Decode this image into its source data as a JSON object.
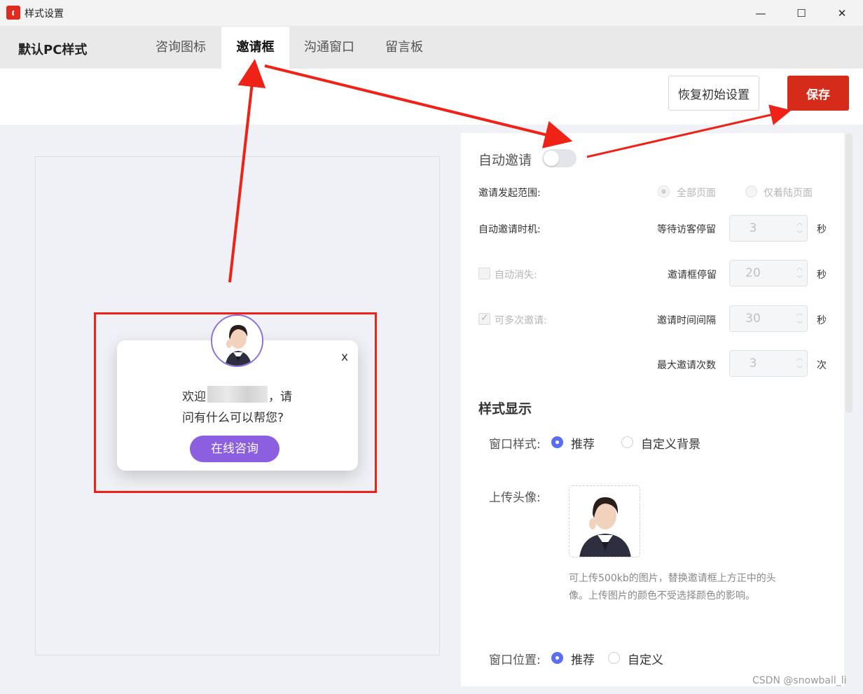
{
  "window": {
    "title": "样式设置",
    "minimize": "—",
    "maximize": "☐",
    "close": "✕"
  },
  "header": {
    "brand": "默认PC样式",
    "tabs": [
      {
        "label": "咨询图标"
      },
      {
        "label": "邀请框"
      },
      {
        "label": "沟通窗口"
      },
      {
        "label": "留言板"
      }
    ],
    "active_tab": "邀请框"
  },
  "toolbar": {
    "reset_label": "恢复初始设置",
    "save_label": "保存"
  },
  "preview": {
    "close_label": "x",
    "welcome_prefix": "欢迎",
    "welcome_suffix": "，请",
    "welcome_line2": "问有什么可以帮您?",
    "consult_button": "在线咨询"
  },
  "settings": {
    "auto_invite_label": "自动邀请",
    "auto_invite_on": false,
    "range_label": "邀请发起范围:",
    "range_options": [
      "全部页面",
      "仅着陆页面"
    ],
    "timing_label": "自动邀请时机:",
    "wait_label": "等待访客停留",
    "wait_value": "3",
    "wait_unit": "秒",
    "auto_dismiss_label": "自动消失:",
    "dismiss_label": "邀请框停留",
    "dismiss_value": "20",
    "dismiss_unit": "秒",
    "multi_label": "可多次邀请:",
    "interval_label": "邀请时间间隔",
    "interval_value": "30",
    "interval_unit": "秒",
    "max_label": "最大邀请次数",
    "max_value": "3",
    "max_unit": "次",
    "style_section": "样式显示",
    "window_style_label": "窗口样式:",
    "window_style_options": [
      "推荐",
      "自定义背景"
    ],
    "upload_label": "上传头像:",
    "upload_hint_line1": "可上传500kb的图片，替换邀请框上方正中的头",
    "upload_hint_line2": "像。上传图片的颜色不受选择颜色的影响。",
    "position_label": "窗口位置:",
    "position_options": [
      "推荐",
      "自定义"
    ]
  },
  "watermark": "CSDN @snowball_li",
  "colors": {
    "accent_red": "#d42b1a",
    "consult_purple": "#8c5fe0",
    "radio_blue": "#5b6df0",
    "annotation_red": "#ef2218"
  }
}
